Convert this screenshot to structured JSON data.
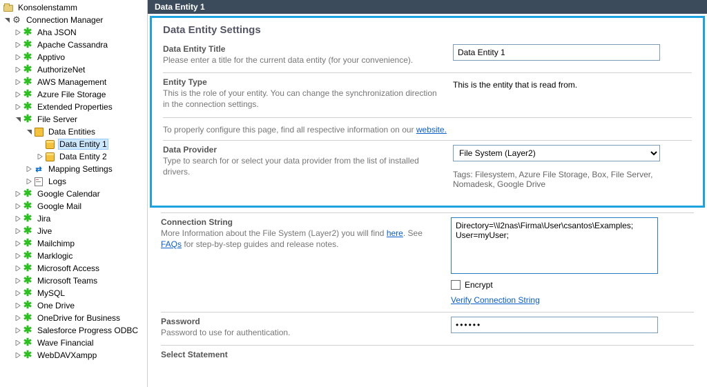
{
  "tree": {
    "root": "Konsolenstamm",
    "connection_manager": "Connection Manager",
    "connections": [
      "Aha JSON",
      "Apache Cassandra",
      "Apptivo",
      "AuthorizeNet",
      "AWS Management",
      "Azure File Storage",
      "Extended Properties"
    ],
    "file_server": "File Server",
    "data_entities": "Data Entities",
    "data_entity_1": "Data Entity 1",
    "data_entity_2": "Data Entity 2",
    "mapping_settings": "Mapping Settings",
    "logs": "Logs",
    "connections2": [
      "Google Calendar",
      "Google Mail",
      "Jira",
      "Jive",
      "Mailchimp",
      "Marklogic",
      "Microsoft Access",
      "Microsoft Teams",
      "MySQL",
      "One Drive",
      "OneDrive for Business",
      "Salesforce Progress ODBC",
      "Wave Financial",
      "WebDAVXampp"
    ]
  },
  "header": {
    "title": "Data Entity 1"
  },
  "settings": {
    "section_title": "Data Entity Settings",
    "title_label": "Data Entity Title",
    "title_help": "Please enter a title for the current data entity (for your convenience).",
    "title_value": "Data Entity 1",
    "type_label": "Entity Type",
    "type_help": "This is the role of your entity. You can change the synchronization direction in the connection settings.",
    "type_value": "This is the entity that is read from.",
    "info_prefix": "To properly configure this page, find all respective information on our ",
    "info_link": "website.",
    "provider_label": "Data Provider",
    "provider_help": "Type to search for or select your data provider from the list of installed drivers.",
    "provider_value": "File System (Layer2)",
    "tags": "Tags: Filesystem, Azure File Storage, Box, File Server, Nomadesk, Google Drive",
    "conn_label": "Connection String",
    "conn_help_prefix": "More Information about the File System (Layer2) you will find ",
    "conn_help_here": "here",
    "conn_help_mid": ". See ",
    "conn_help_faq": "FAQs",
    "conn_help_suffix": " for step-by-step guides and release notes.",
    "conn_value": "Directory=\\\\l2nas\\Firma\\User\\csantos\\Examples;\nUser=myUser;",
    "encrypt_label": "Encrypt",
    "verify_label": "Verify Connection String",
    "pw_label": "Password",
    "pw_help": "Password to use for authentication.",
    "pw_value": "••••••",
    "select_label": "Select Statement"
  }
}
